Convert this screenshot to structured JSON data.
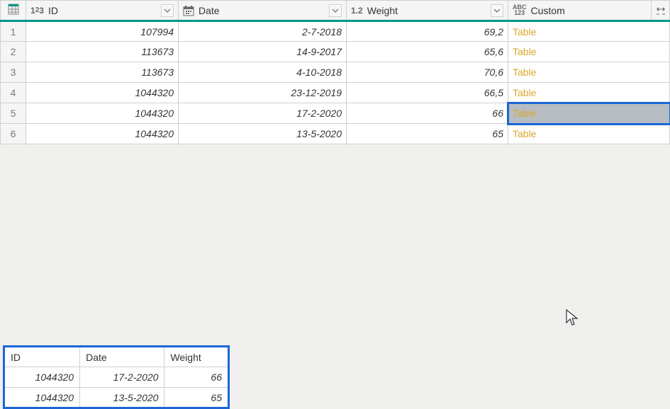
{
  "table": {
    "columns": {
      "id": {
        "label": "ID",
        "type_icon": "1²3"
      },
      "date": {
        "label": "Date",
        "type_icon": "calendar"
      },
      "weight": {
        "label": "Weight",
        "type_icon": "1.2"
      },
      "custom": {
        "label": "Custom",
        "type_icon": "ABC123"
      }
    },
    "rows": [
      {
        "n": "1",
        "id": "107994",
        "date": "2-7-2018",
        "weight": "69,2",
        "custom": "Table"
      },
      {
        "n": "2",
        "id": "113673",
        "date": "14-9-2017",
        "weight": "65,6",
        "custom": "Table"
      },
      {
        "n": "3",
        "id": "113673",
        "date": "4-10-2018",
        "weight": "70,6",
        "custom": "Table"
      },
      {
        "n": "4",
        "id": "1044320",
        "date": "23-12-2019",
        "weight": "66,5",
        "custom": "Table"
      },
      {
        "n": "5",
        "id": "1044320",
        "date": "17-2-2020",
        "weight": "66",
        "custom": "Table"
      },
      {
        "n": "6",
        "id": "1044320",
        "date": "13-5-2020",
        "weight": "65",
        "custom": "Table"
      }
    ],
    "selected_cell": {
      "row": 5,
      "col": "custom"
    }
  },
  "detail": {
    "columns": {
      "id": "ID",
      "date": "Date",
      "weight": "Weight"
    },
    "rows": [
      {
        "id": "1044320",
        "date": "17-2-2020",
        "weight": "66"
      },
      {
        "id": "1044320",
        "date": "13-5-2020",
        "weight": "65"
      }
    ]
  }
}
